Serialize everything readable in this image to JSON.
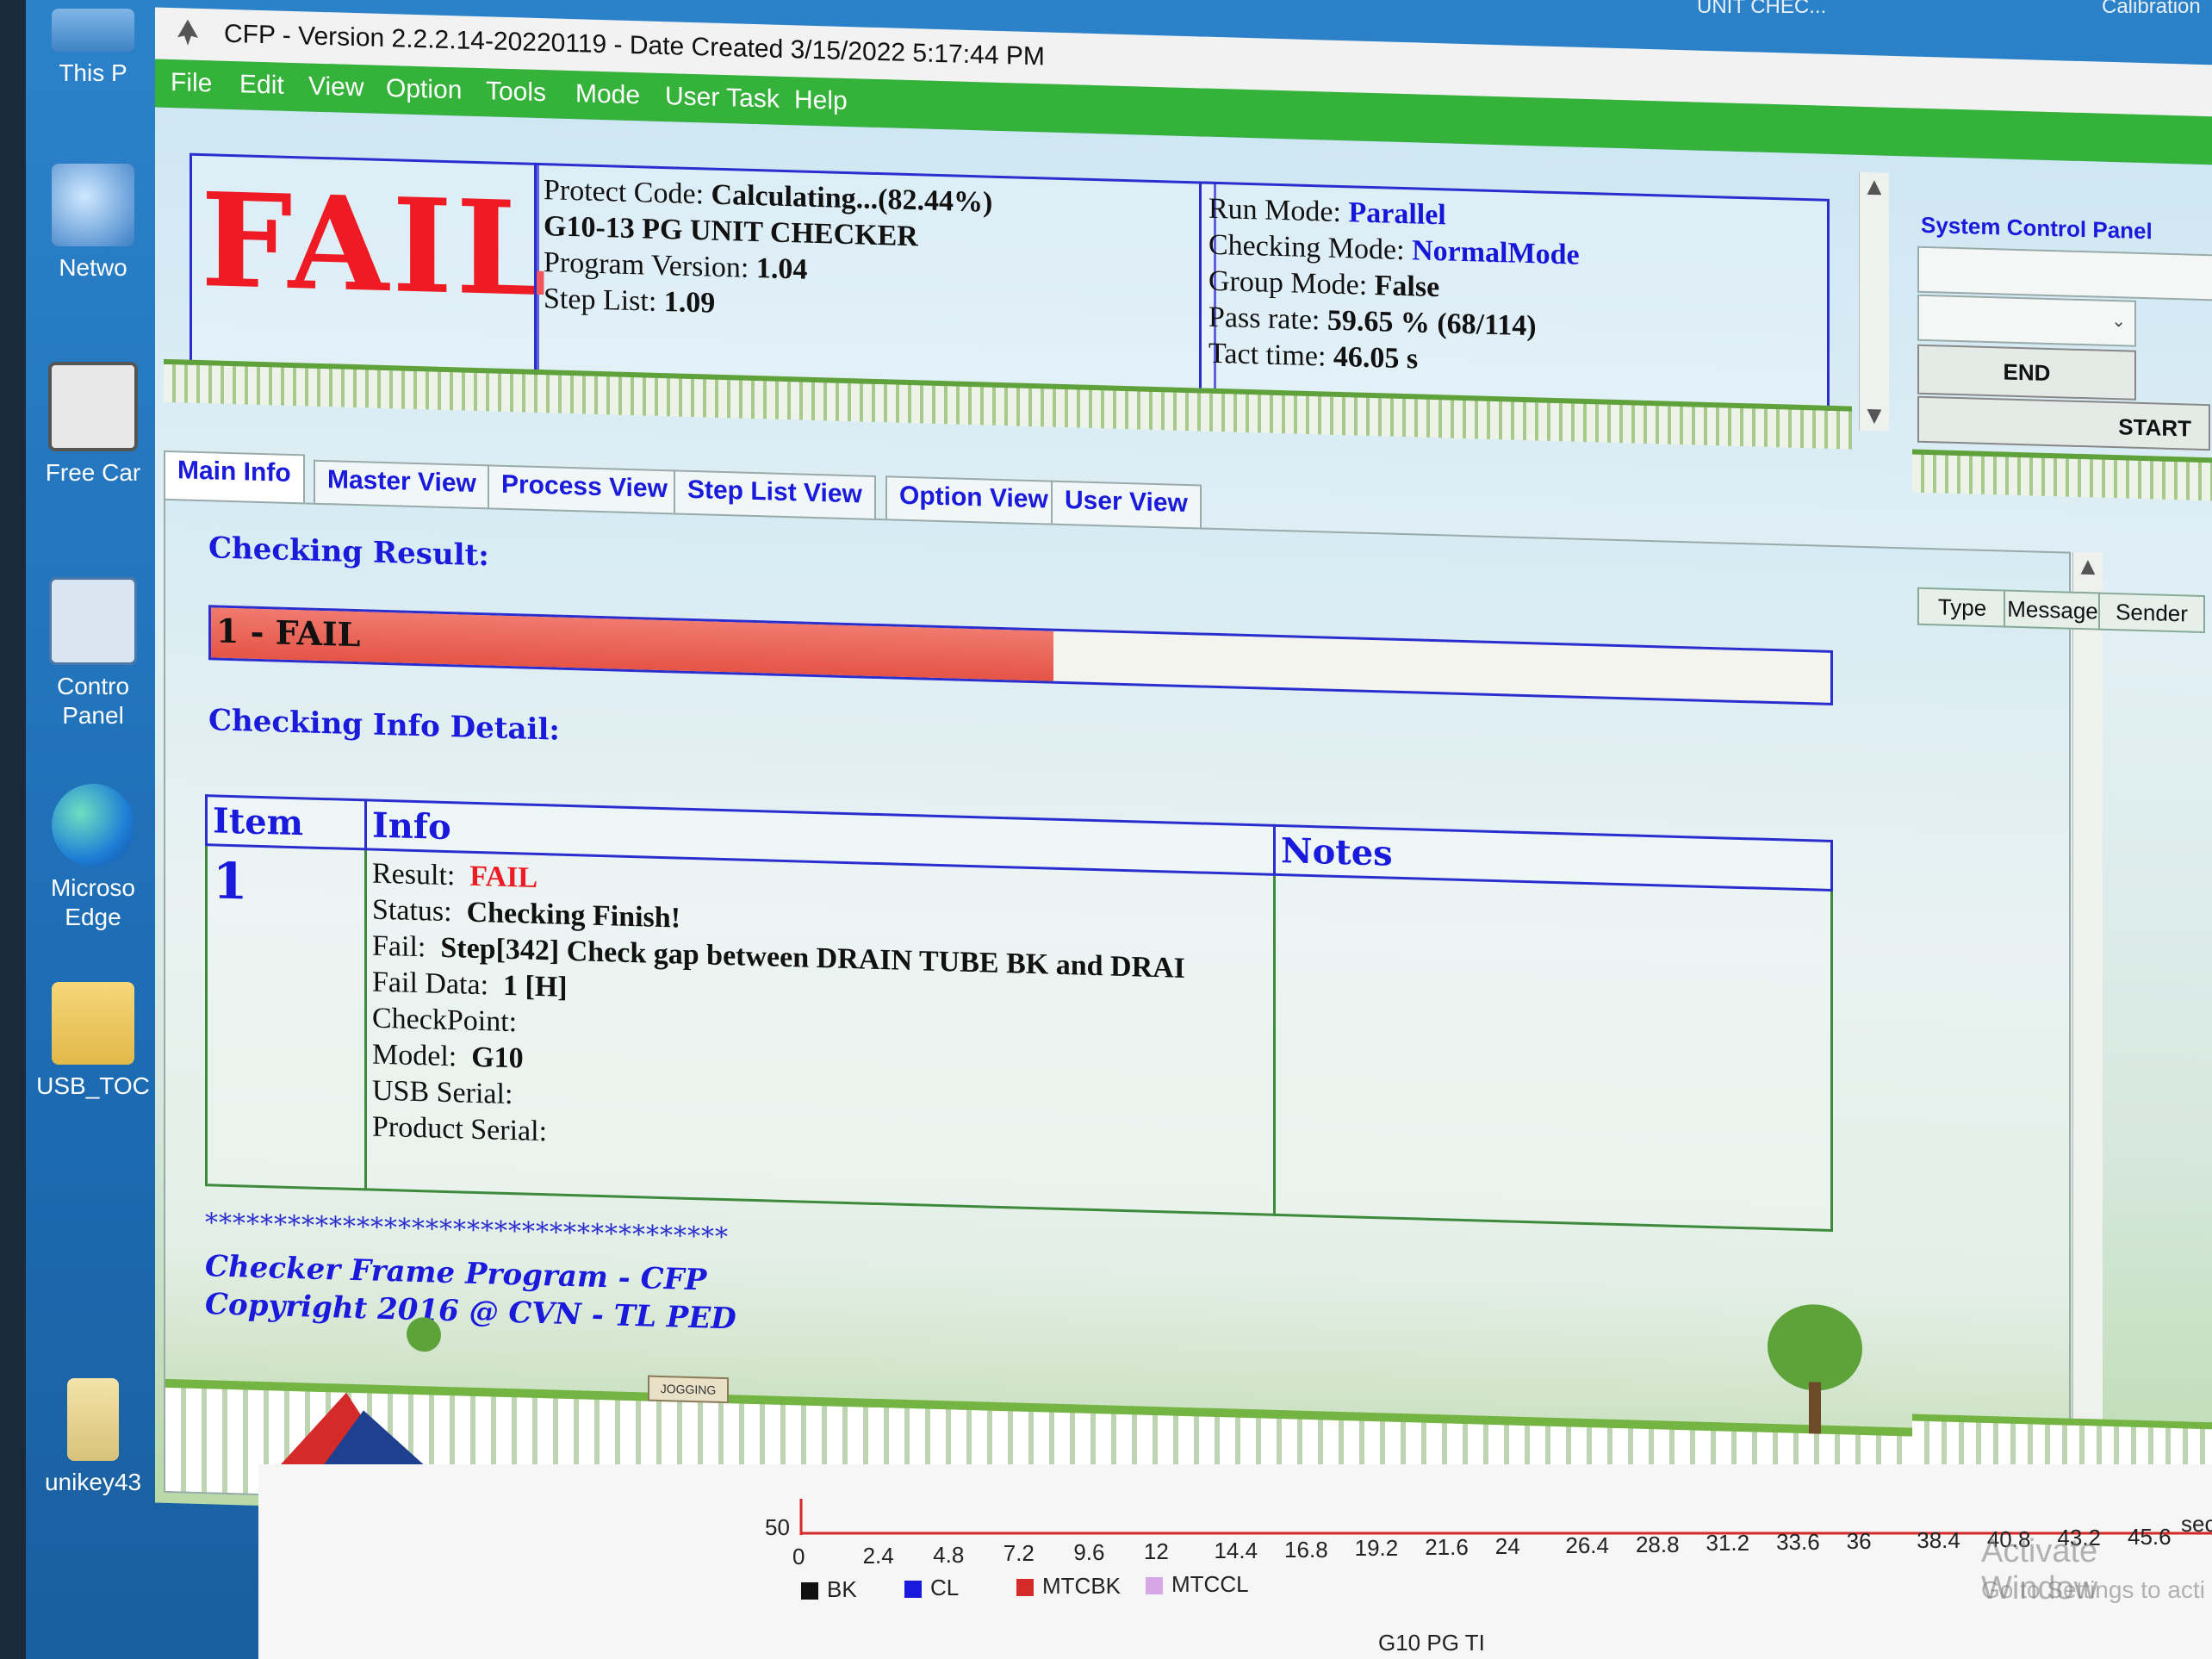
{
  "desktop": {
    "icons": [
      {
        "label": "This P",
        "name": "this-pc"
      },
      {
        "label": "Netwo",
        "name": "network"
      },
      {
        "label": "Free Car",
        "name": "free-car"
      },
      {
        "label": "Contro\nPanel",
        "name": "control-panel"
      },
      {
        "label": "Microso\nEdge",
        "name": "microsoft-edge"
      },
      {
        "label": "USB_TOC",
        "name": "usb-toc"
      },
      {
        "label": "unikey43",
        "name": "unikey"
      }
    ],
    "top_texts": [
      "UNIT CHEC...",
      "Calibration"
    ]
  },
  "window": {
    "title": "CFP - Version 2.2.2.14-20220119 - Date Created 3/15/2022 5:17:44 PM",
    "menu": [
      "File",
      "Edit",
      "View",
      "Option",
      "Tools",
      "Mode",
      "User Task",
      "Help"
    ]
  },
  "header": {
    "status_big": "FAIL",
    "protect_code_label": "Protect Code:",
    "protect_code_value": "Calculating...(82.44%)",
    "program_name": "G10-13 PG UNIT CHECKER",
    "program_version_label": "Program Version:",
    "program_version_value": "1.04",
    "step_list_label": "Step List:",
    "step_list_value": "1.09",
    "run_mode_label": "Run Mode:",
    "run_mode_value": "Parallel",
    "checking_mode_label": "Checking Mode:",
    "checking_mode_value": "NormalMode",
    "group_mode_label": "Group Mode:",
    "group_mode_value": "False",
    "pass_rate_label": "Pass rate:",
    "pass_rate_value": "59.65 % (68/114)",
    "tact_time_label": "Tact time:",
    "tact_time_value": "46.05 s"
  },
  "system_control_panel": {
    "title": "System Control Panel",
    "end_label": "END",
    "start_label": "START"
  },
  "tabs": [
    "Main Info",
    "Master View",
    "Process View",
    "Step List View",
    "Option View",
    "User View"
  ],
  "main_info": {
    "checking_result_title": "Checking Result:",
    "result_bar_label": "1 - FAIL",
    "result_bar_fraction": 0.52,
    "checking_detail_title": "Checking Info Detail:",
    "columns": [
      "Item",
      "Info",
      "Notes"
    ],
    "row": {
      "item": "1",
      "result_label": "Result:",
      "result_value": "FAIL",
      "status_label": "Status:",
      "status_value": "Checking Finish!",
      "fail_label": "Fail:",
      "fail_value": "Step[342] Check gap between DRAIN TUBE BK and DRAI",
      "fail_data_label": "Fail Data:",
      "fail_data_value": "1 [H]",
      "checkpoint_label": "CheckPoint:",
      "model_label": "Model:",
      "model_value": "G10",
      "usb_serial_label": "USB Serial:",
      "product_serial_label": "Product Serial:"
    },
    "stars": "**************************************",
    "footer_line1": "Checker Frame Program - CFP",
    "footer_line2": "Copyright 2016 @ CVN - TL PED",
    "sign_text": "JOGGING"
  },
  "log_panel": {
    "columns": [
      "Type",
      "Message",
      "Sender"
    ]
  },
  "bottom_chart": {
    "y_label": "50",
    "x_ticks": [
      "0",
      "2.4",
      "4.8",
      "7.2",
      "9.6",
      "12",
      "14.4",
      "16.8",
      "19.2",
      "21.6",
      "24",
      "26.4",
      "28.8",
      "31.2",
      "33.6",
      "36",
      "38.4",
      "40.8",
      "43.2",
      "45.6"
    ],
    "x_unit": "sec",
    "legend": [
      {
        "name": "BK",
        "color": "#111111"
      },
      {
        "name": "CL",
        "color": "#1a1adc"
      },
      {
        "name": "MTCBK",
        "color": "#d42a2a"
      },
      {
        "name": "MTCCL",
        "color": "#d7a6e6"
      }
    ],
    "bottom_label": "G10 PG TI",
    "watermark_line1": "Activate Window",
    "watermark_line2": "Go to Settings to acti"
  },
  "colors": {
    "menubar": "#35b23a",
    "fail_red": "#ee1b24",
    "accent_blue": "#1a1adc",
    "border_blue": "#2a2ecf"
  }
}
